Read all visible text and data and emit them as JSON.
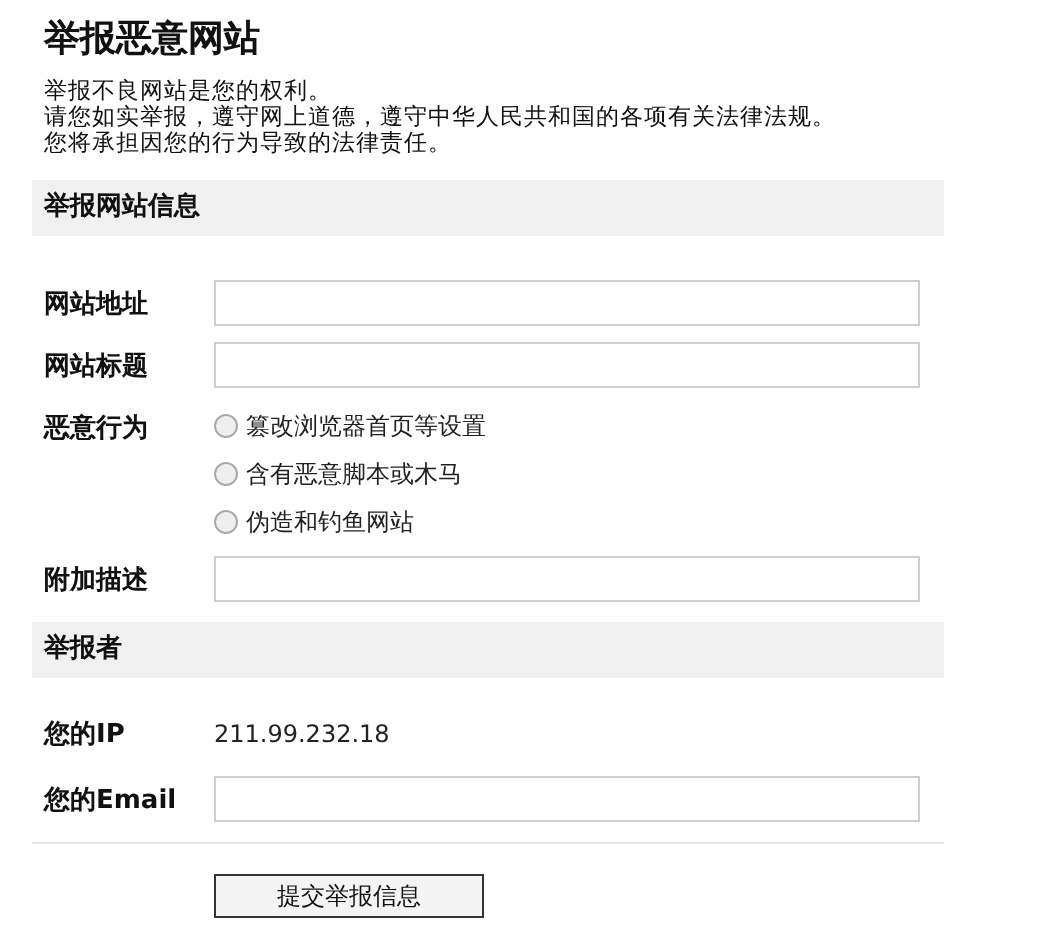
{
  "title": "举报恶意网站",
  "intro": [
    "举报不良网站是您的权利。",
    "请您如实举报，遵守网上道德，遵守中华人民共和国的各项有关法律法规。",
    "您将承担因您的行为导致的法律责任。"
  ],
  "sections": [
    {
      "heading": "举报网站信息",
      "rows": [
        {
          "kind": "field",
          "label": "网站地址"
        },
        {
          "kind": "field",
          "label": "网站标题"
        },
        {
          "kind": "radios",
          "label": "恶意行为",
          "options": [
            {
              "label": "篡改浏览器首页等设置",
              "selected": false
            },
            {
              "label": "含有恶意脚本或木马",
              "selected": false
            },
            {
              "label": "伪造和钓鱼网站",
              "selected": false
            }
          ]
        },
        {
          "kind": "field",
          "label": "附加描述"
        }
      ]
    },
    {
      "heading": "举报者",
      "rows": [
        {
          "kind": "text",
          "label": "您的IP",
          "value": "211.99.232.18"
        },
        {
          "kind": "field",
          "label": "您的Email"
        }
      ]
    }
  ],
  "submit": "提交举报信息"
}
